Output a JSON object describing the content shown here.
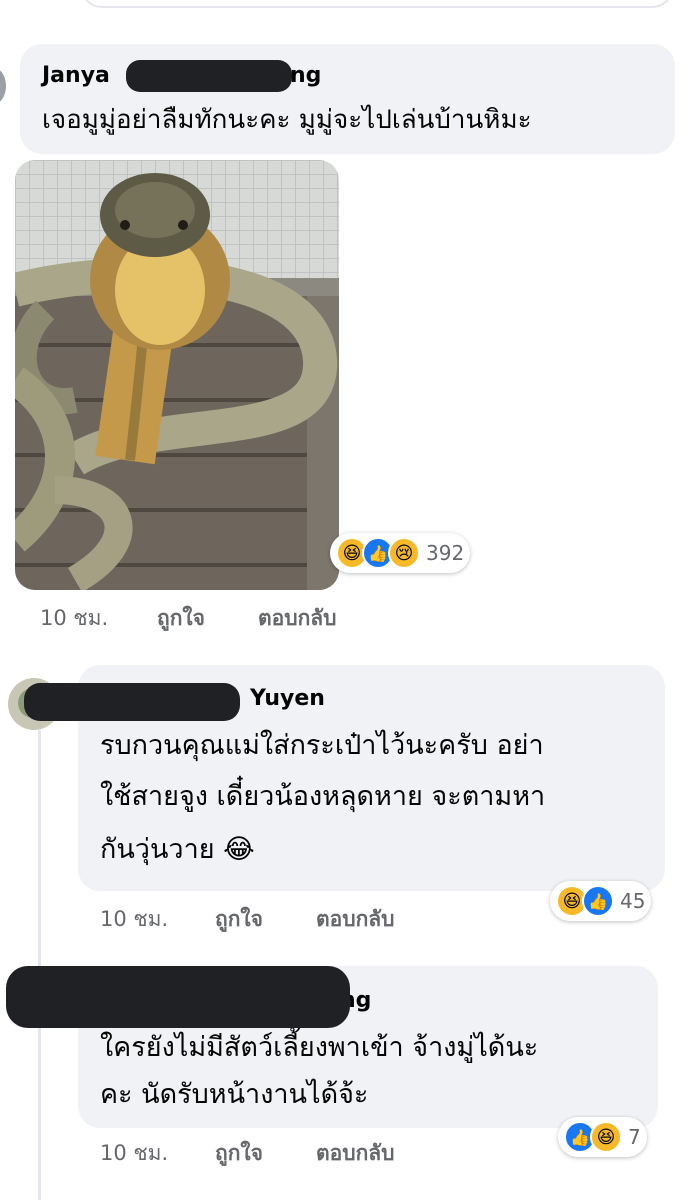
{
  "comments": [
    {
      "author_visible": "Janya",
      "author_suffix": "ng",
      "text": "เจอมูมู่อย่าลืมทักนะคะ มูมู่จะไปเล่นบ้านหิมะ",
      "image_alt": "king-cobra-photo",
      "reaction_count": "392",
      "time": "10 ชม.",
      "like_label": "ถูกใจ",
      "reply_label": "ตอบกลับ"
    },
    {
      "author_suffix": "Yuyen",
      "text_lines": [
        "รบกวนคุณแม่ใส่กระเป๋าไว้นะครับ อย่า",
        "ใช้สายจูง เดี๋ยวน้องหลุดหาย จะตามหา",
        "กันวุ่นวาย 😂"
      ],
      "reaction_count": "45",
      "time": "10 ชม.",
      "like_label": "ถูกใจ",
      "reply_label": "ตอบกลับ"
    },
    {
      "author_suffix": "ng",
      "text_lines": [
        "ใครยังไม่มีสัตว์เลี้ยงพาเข้า จ้างมู่ได้นะ",
        "คะ นัดรับหน้างานได้จ้ะ"
      ],
      "reaction_count": "7",
      "time": "10 ชม.",
      "like_label": "ถูกใจ",
      "reply_label": "ตอบกลับ"
    }
  ],
  "colors": {
    "bubble": "#f0f2f5",
    "meta": "#65676b",
    "like_blue": "#1877f2",
    "haha_yellow": "#f7b928"
  }
}
